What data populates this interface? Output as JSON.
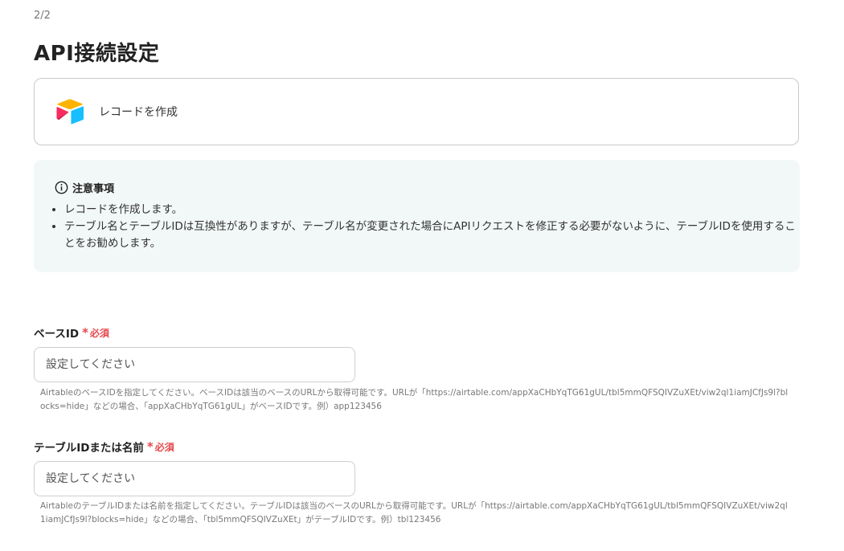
{
  "step": "2/2",
  "title": "API接続設定",
  "action": {
    "label": "レコードを作成",
    "logo_icon": "airtable-logo-icon",
    "logo_colors": {
      "yellow": "#fcb400",
      "blue": "#18bfff",
      "red": "#f82b60",
      "dark_red": "#ba1e45"
    }
  },
  "notice": {
    "icon": "info-icon",
    "heading": "注意事項",
    "items": [
      "レコードを作成します。",
      "テーブル名とテーブルIDは互換性がありますが、テーブル名が変更された場合にAPIリクエストを修正する必要がないように、テーブルIDを使用することをお勧めします。"
    ],
    "background": "#f2f8f7"
  },
  "fields": [
    {
      "label": "ベースID",
      "required_mark": "*",
      "required_text": "必須",
      "value": "",
      "placeholder": "設定してください",
      "help": "AirtableのベースIDを指定してください。ベースIDは該当のベースのURLから取得可能です。URLが「https://airtable.com/appXaCHbYqTG61gUL/tbl5mmQFSQIVZuXEt/viw2ql1iamJCfJs9l?blocks=hide」などの場合、「appXaCHbYqTG61gUL」がベースIDです。例）app123456"
    },
    {
      "label": "テーブルIDまたは名前",
      "required_mark": "*",
      "required_text": "必須",
      "value": "",
      "placeholder": "設定してください",
      "help": "AirtableのテーブルIDまたは名前を指定してください。テーブルIDは該当のベースのURLから取得可能です。URLが「https://airtable.com/appXaCHbYqTG61gUL/tbl5mmQFSQIVZuXEt/viw2ql1iamJCfJs9l?blocks=hide」などの場合、「tbl5mmQFSQIVZuXEt」がテーブルIDです。例）tbl123456"
    }
  ],
  "colors": {
    "required": "#e5484d",
    "border": "#cfcfcf",
    "help_text": "#777777"
  }
}
